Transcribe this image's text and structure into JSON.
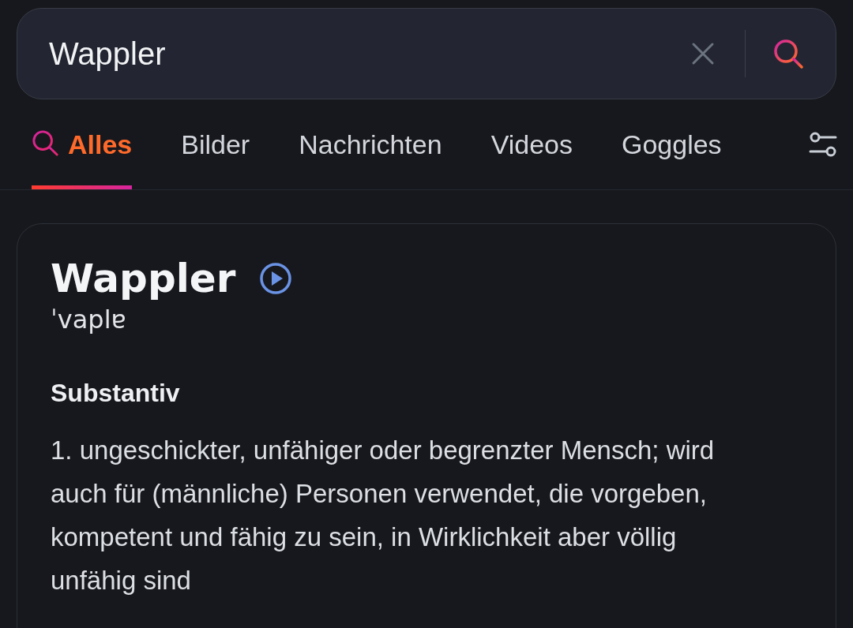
{
  "search": {
    "value": "Wappler"
  },
  "tabs": [
    {
      "label": "Alles",
      "selected": true,
      "kind": "search"
    },
    {
      "label": "Bilder",
      "selected": false,
      "kind": "plain"
    },
    {
      "label": "Nachrichten",
      "selected": false,
      "kind": "plain"
    },
    {
      "label": "Videos",
      "selected": false,
      "kind": "plain"
    },
    {
      "label": "Goggles",
      "selected": false,
      "kind": "plain"
    }
  ],
  "definition": {
    "word": "Wappler",
    "pronunciation": "ˈvaplɐ",
    "part_of_speech": "Substantiv",
    "senses": [
      "1. ungeschickter, unfähiger oder begrenzter Mensch; wird auch für (männliche) Personen verwendet, die vorgeben, kompetent und fähig zu sein, in Wirklichkeit aber völlig unfähig sind"
    ]
  }
}
